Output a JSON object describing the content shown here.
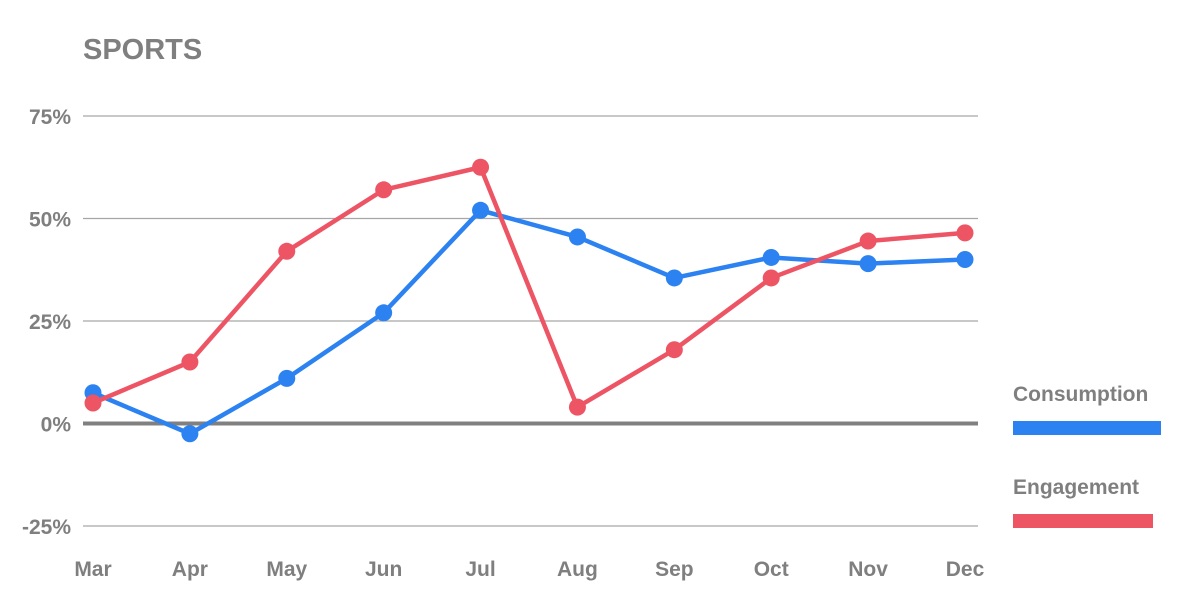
{
  "chart_data": {
    "type": "line",
    "title": "SPORTS",
    "xlabel": "",
    "ylabel": "",
    "categories": [
      "Mar",
      "Apr",
      "May",
      "Jun",
      "Jul",
      "Aug",
      "Sep",
      "Oct",
      "Nov",
      "Dec"
    ],
    "y_ticks": [
      75,
      50,
      25,
      0,
      -25
    ],
    "y_tick_labels": [
      "75%",
      "50%",
      "25%",
      "0%",
      "-25%"
    ],
    "ylim": [
      -25,
      75
    ],
    "grid": true,
    "legend_position": "right",
    "series": [
      {
        "name": "Consumption",
        "color": "#2b82f0",
        "values": [
          7.5,
          -2.5,
          11,
          27,
          52,
          45.5,
          35.5,
          40.5,
          39,
          40
        ]
      },
      {
        "name": "Engagement",
        "color": "#ed5565",
        "values": [
          5,
          15,
          42,
          57,
          62.5,
          4,
          18,
          35.5,
          44.5,
          46.5
        ]
      }
    ]
  },
  "colors": {
    "text": "#7f7f7f",
    "grid": "#a6a6a6",
    "zero_line": "#808080"
  }
}
